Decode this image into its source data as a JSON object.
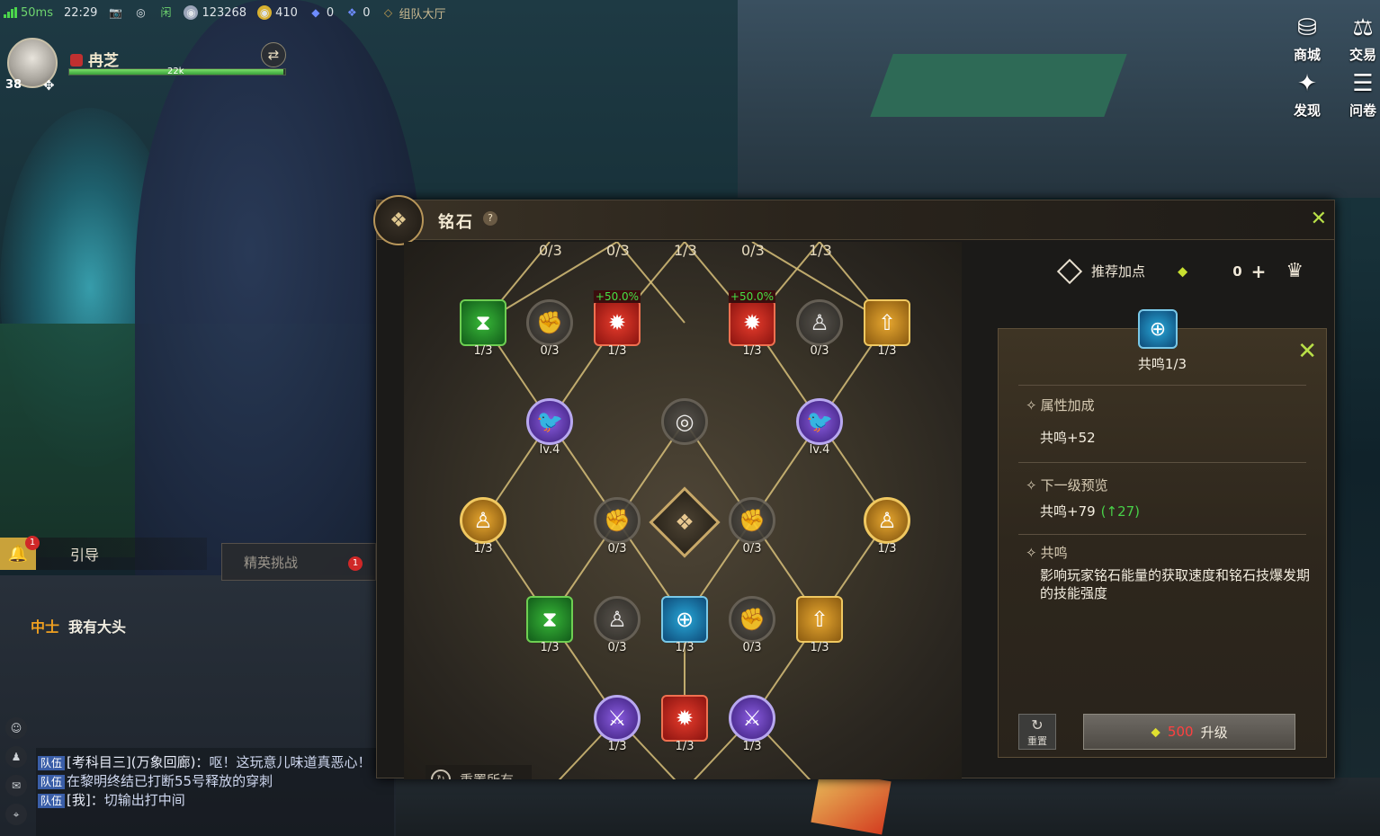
{
  "status": {
    "ping": "50ms",
    "time": "22:29",
    "currency1": "123268",
    "currency2": "410",
    "currency3": "0",
    "currency4": "0",
    "lobby": "组队大厅"
  },
  "player": {
    "name": "冉芝",
    "level": "38",
    "hp_label": "22k",
    "hp_fraction": 0.99
  },
  "topright": {
    "shop": "商城",
    "trade": "交易",
    "discover": "发现",
    "quest": "问卷"
  },
  "hud": {
    "guide": "引导",
    "guide_badge": "1",
    "elite": "精英挑战",
    "elite_badge": "1",
    "npc_rank": "中士",
    "npc_name": "我有大头"
  },
  "chat": [
    {
      "tag": "队伍",
      "who": "[考科目三](万象回廊)：",
      "text": "呕！这玩意儿味道真恶心！"
    },
    {
      "tag": "队伍",
      "who": "",
      "text": "在黎明终结已打断55号释放的穿刺"
    },
    {
      "tag": "队伍",
      "who": "[我]：",
      "text": "切输出打中间"
    }
  ],
  "modal": {
    "title": "铭石",
    "help": "?",
    "close": "✕",
    "reset_all": "重置所有"
  },
  "tree": {
    "top_row": [
      "0/3",
      "0/3",
      "1/3",
      "0/3",
      "1/3"
    ],
    "row1": [
      {
        "type": "green",
        "count": "1/3",
        "icon": "hourglass-icon"
      },
      {
        "type": "gray",
        "count": "0/3",
        "icon": "arm-icon"
      },
      {
        "type": "red",
        "count": "1/3",
        "bonus": "+50.0%",
        "icon": "crest-icon"
      },
      {
        "type": "red",
        "count": "1/3",
        "bonus": "+50.0%",
        "icon": "crest-icon"
      },
      {
        "type": "gray",
        "count": "0/3",
        "icon": "body-icon"
      },
      {
        "type": "gold",
        "count": "1/3",
        "icon": "arrow-up-icon"
      }
    ],
    "row2": [
      {
        "level": "lv.4"
      },
      {
        "level": ""
      },
      {
        "level": "lv.4"
      }
    ],
    "row3": [
      "1/3",
      "0/3",
      "0/3",
      "1/3"
    ],
    "row4": [
      "1/3",
      "0/3",
      "1/3",
      "0/3",
      "1/3"
    ],
    "row5": [
      "1/3",
      "1/3",
      "1/3"
    ]
  },
  "panel": {
    "recommend": "推荐加点",
    "points": "0",
    "node_name": "共鸣1/3",
    "attr_title": "属性加成",
    "attr_value": "共鸣+52",
    "next_title": "下一级预览",
    "next_value": "共鸣+79",
    "next_delta": "(↑27)",
    "desc_title": "共鸣",
    "desc_text": "影响玩家铭石能量的获取速度和铭石技爆发期的技能强度",
    "reset": "重置",
    "cost": "500",
    "upgrade": "升级"
  },
  "colors": {
    "accent_green": "#b9e048",
    "cost_red": "#ff4040",
    "gold": "#c8a868"
  }
}
